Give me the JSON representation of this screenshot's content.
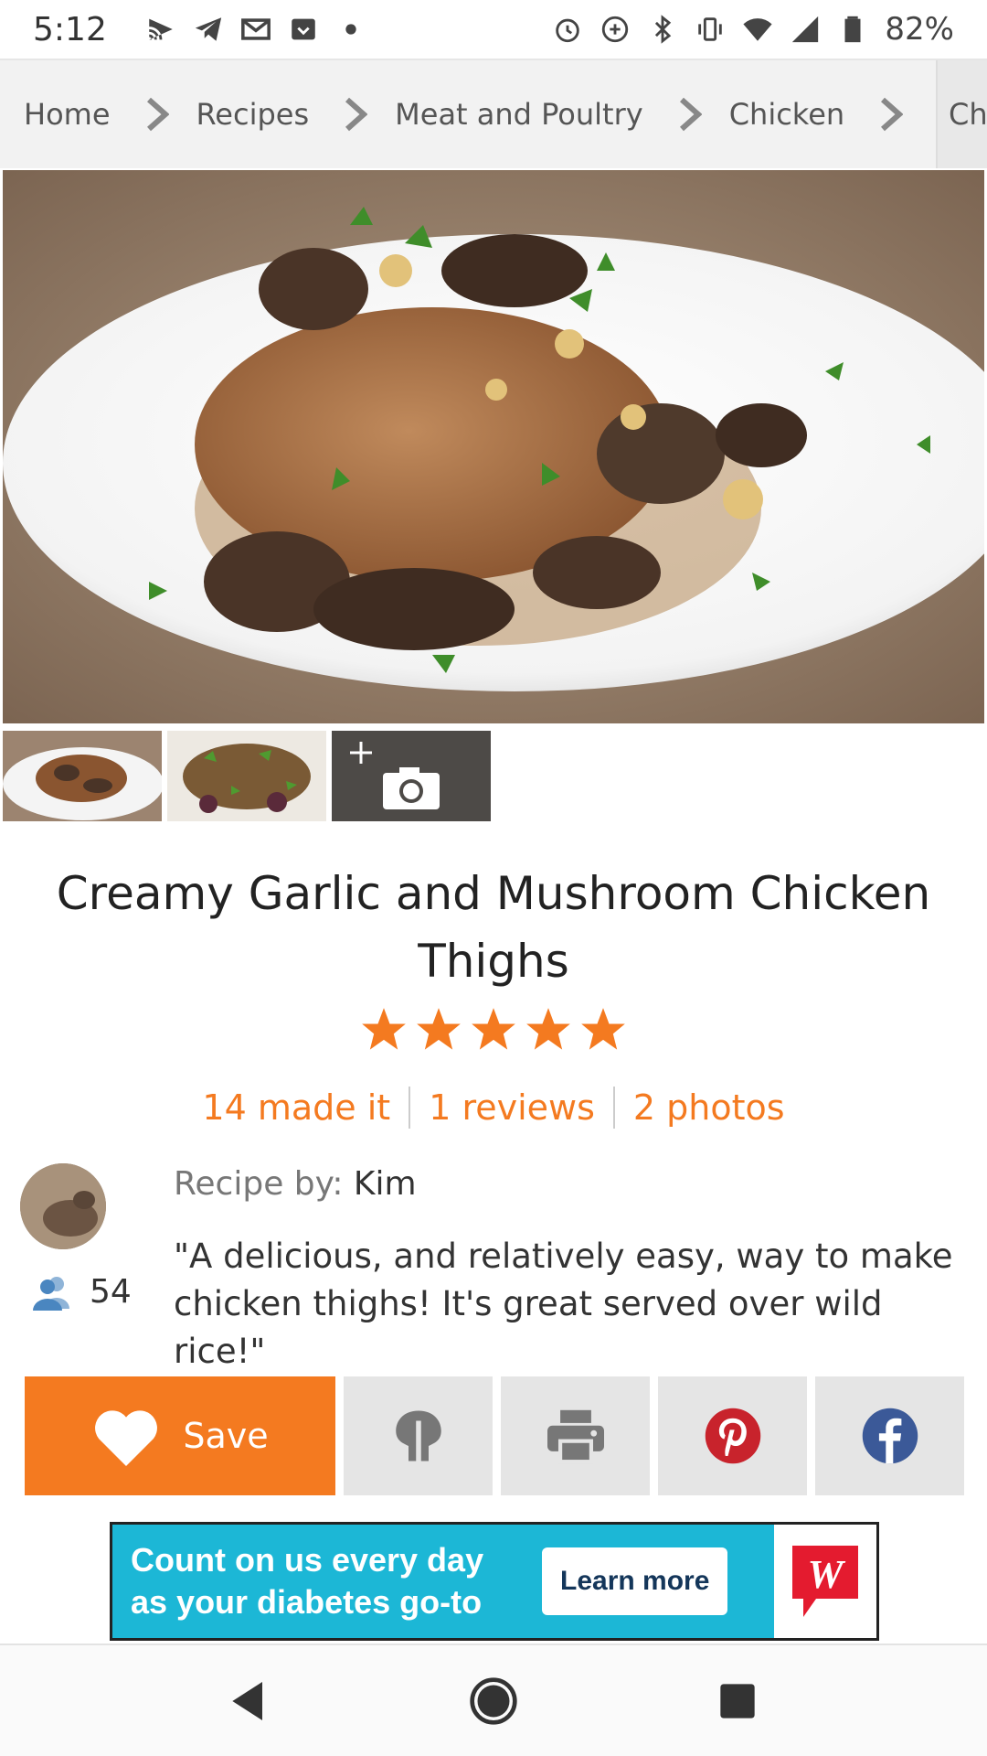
{
  "status_bar": {
    "time": "5:12",
    "battery": "82%"
  },
  "breadcrumb": {
    "items": [
      "Home",
      "Recipes",
      "Meat and Poultry",
      "Chicken"
    ],
    "truncated": "Ch"
  },
  "recipe": {
    "title": "Creamy Garlic and Mushroom Chicken Thighs",
    "rating": 5,
    "rating_max": 5,
    "made_it": "14 made it",
    "reviews": "1 reviews",
    "photos": "2 photos",
    "recipe_by_label": "Recipe by:",
    "author": "Kim",
    "followers": "54",
    "description": "\"A delicious, and relatively easy, way to make chicken thighs! It's great served over wild rice!\""
  },
  "actions": {
    "save_label": "Save"
  },
  "ad": {
    "text_line1": "Count on us every day",
    "text_line2": "as your diabetes go-to",
    "button": "Learn more",
    "logo_letter": "W"
  },
  "colors": {
    "accent": "#f47a20",
    "pinterest": "#c8232c",
    "facebook": "#3b5998",
    "ad_bg": "#1cb7d6"
  },
  "icons": {
    "status_left": [
      "cast-icon",
      "telegram-icon",
      "gmail-icon",
      "inbox-icon",
      "dot-icon"
    ],
    "status_right": [
      "alarm-icon",
      "data-saver-icon",
      "bluetooth-icon",
      "vibrate-icon",
      "wifi-icon",
      "signal-icon",
      "battery-icon"
    ],
    "actions": [
      "heart-icon",
      "made-it-icon",
      "print-icon",
      "pinterest-icon",
      "facebook-icon"
    ],
    "nav": [
      "back-icon",
      "home-icon",
      "recents-icon"
    ]
  }
}
